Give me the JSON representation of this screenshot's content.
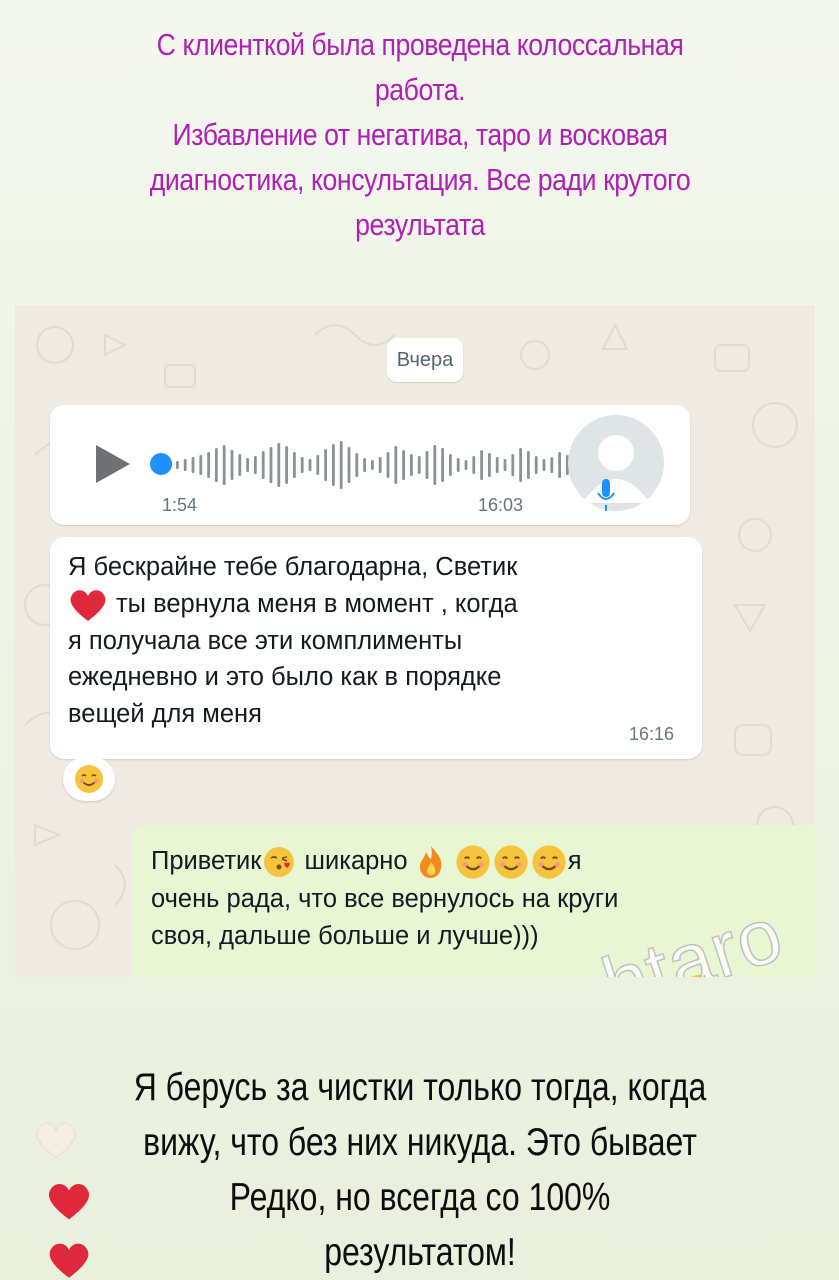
{
  "caption_top": [
    "С клиенткой была проведена колоссальная",
    "работа.",
    "Избавление от негатива, таро и восковая",
    "диагностика, консультация. Все ради крутого",
    "результата"
  ],
  "chat": {
    "date_label": "Вчера",
    "voice_message": {
      "duration": "1:54",
      "time": "16:03",
      "accent_color": "#1e90ff"
    },
    "incoming_message": {
      "text_line1": "Я бескрайне тебе благодарна, Светик",
      "text_line2": "ты вернула меня в момент , когда",
      "text_line3": "я получала все эти комплименты",
      "text_line4": "ежедневно и это было как в порядке",
      "text_line5": "вещей для меня",
      "time": "16:16",
      "reaction_icon": "smiling-face-icon"
    },
    "outgoing_message": {
      "text_part1": "Приветик",
      "text_part2": " шикарно ",
      "text_part3": "я",
      "text_line2": "очень рада, что все вернулось на круги",
      "text_line3": "своя, дальше больше и лучше)))"
    },
    "watermark": "@Svetochtaro"
  },
  "caption_bottom": [
    "Я берусь за чистки только тогда, когда",
    "вижу, что без них никуда. Это бывает",
    "Редко, но всегда со 100% результатом!"
  ],
  "colors": {
    "caption_top": "#b01fb6",
    "outgoing_bubble": "#e8f6d3",
    "chat_background": "#efeae2",
    "heart_red": "#e0283c"
  }
}
